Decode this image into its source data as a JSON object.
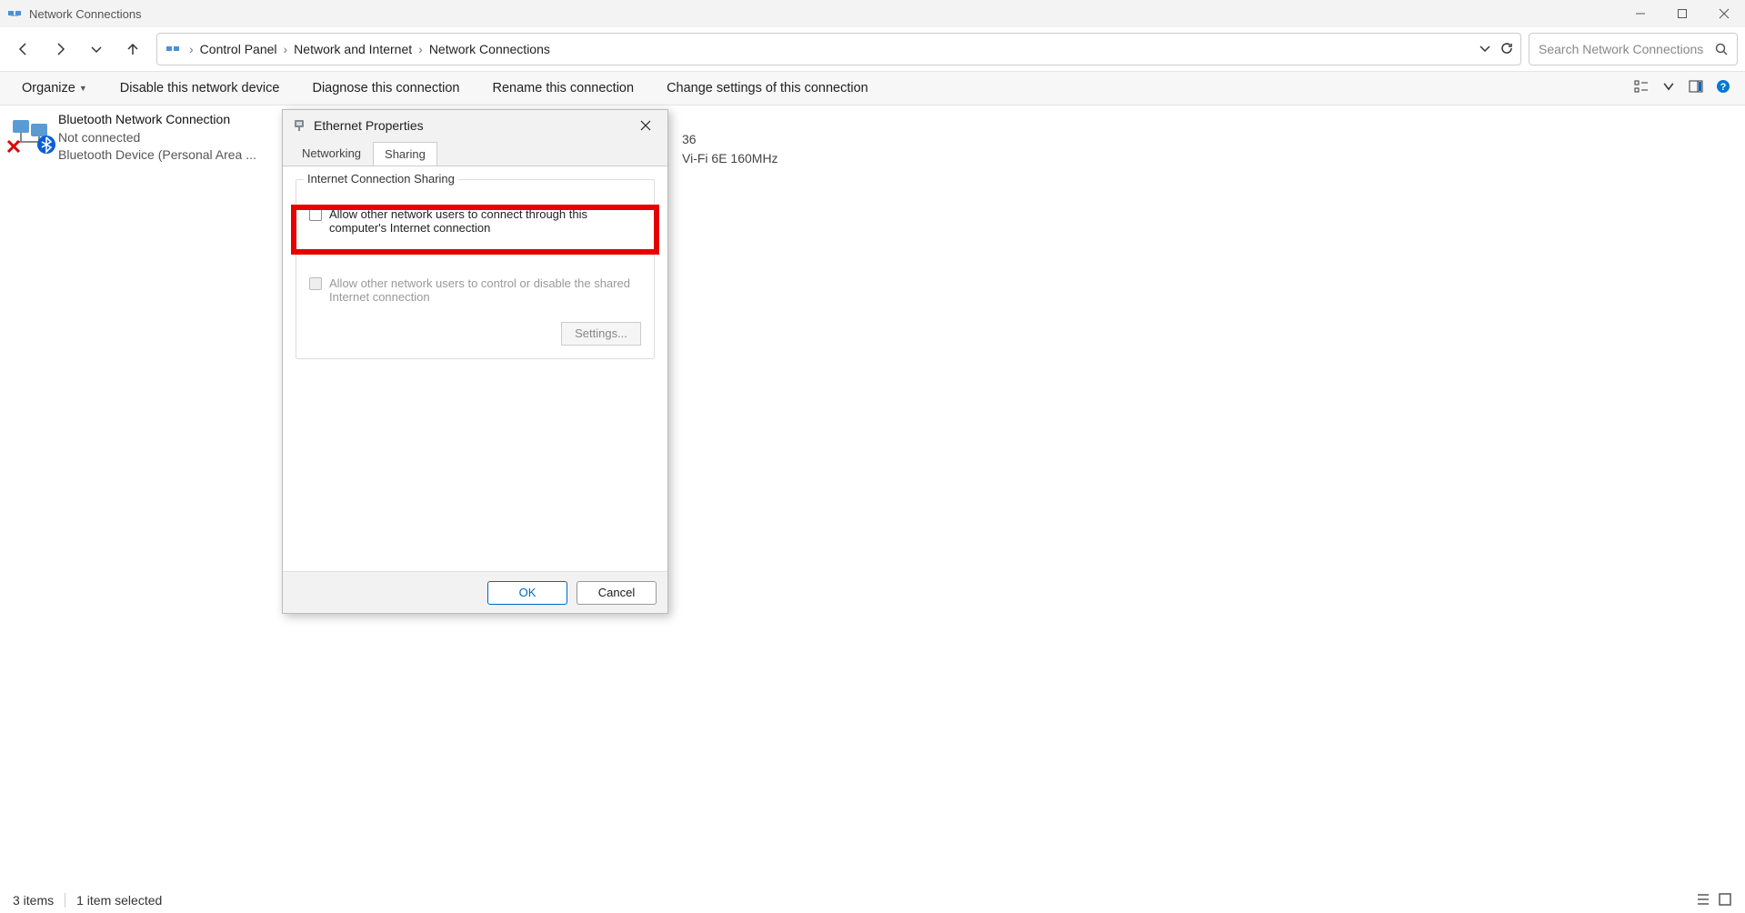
{
  "window": {
    "title": "Network Connections"
  },
  "breadcrumb": {
    "item1": "Control Panel",
    "item2": "Network and Internet",
    "item3": "Network Connections"
  },
  "search": {
    "placeholder": "Search Network Connections"
  },
  "toolbar": {
    "organize": "Organize",
    "disable": "Disable this network device",
    "diagnose": "Diagnose this connection",
    "rename": "Rename this connection",
    "change": "Change settings of this connection"
  },
  "connections": {
    "bluetooth": {
      "name": "Bluetooth Network Connection",
      "status": "Not connected",
      "device": "Bluetooth Device (Personal Area ..."
    },
    "partial": {
      "line1": "36",
      "line2": "Vi-Fi 6E 160MHz"
    }
  },
  "dialog": {
    "title": "Ethernet Properties",
    "tabs": {
      "networking": "Networking",
      "sharing": "Sharing"
    },
    "group_title": "Internet Connection Sharing",
    "checkbox1": "Allow other network users to connect through this computer's Internet connection",
    "checkbox2": "Allow other network users to control or disable the shared Internet connection",
    "settings_btn": "Settings...",
    "ok": "OK",
    "cancel": "Cancel"
  },
  "statusbar": {
    "count": "3 items",
    "selected": "1 item selected"
  }
}
